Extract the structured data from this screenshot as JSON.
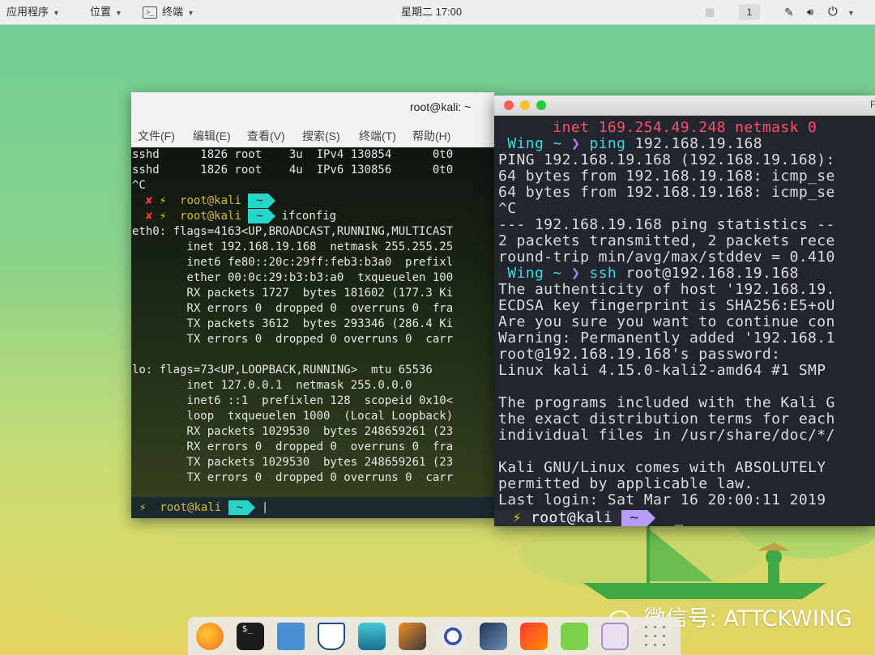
{
  "topbar": {
    "apps_menu": "应用程序",
    "places_menu": "位置",
    "terminal_menu": "终端",
    "clock": "星期二 17:00",
    "workspace": "1"
  },
  "term1": {
    "title": "root@kali: ~",
    "menu": [
      "文件(F)",
      "编辑(E)",
      "查看(V)",
      "搜索(S)",
      "终端(T)",
      "帮助(H)"
    ],
    "lines": [
      "sshd      1826 root    3u  IPv4 130854      0t0",
      "sshd      1826 root    4u  IPv6 130856      0t0",
      "^C",
      "",
      "",
      "eth0: flags=4163<UP,BROADCAST,RUNNING,MULTICAST",
      "        inet 192.168.19.168  netmask 255.255.25",
      "        inet6 fe80::20c:29ff:feb3:b3a0  prefixl",
      "        ether 00:0c:29:b3:b3:a0  txqueuelen 100",
      "        RX packets 1727  bytes 181602 (177.3 Ki",
      "        RX errors 0  dropped 0  overruns 0  fra",
      "        TX packets 3612  bytes 293346 (286.4 Ki",
      "        TX errors 0  dropped 0 overruns 0  carr",
      "",
      "lo: flags=73<UP,LOOPBACK,RUNNING>  mtu 65536",
      "        inet 127.0.0.1  netmask 255.0.0.0",
      "        inet6 ::1  prefixlen 128  scopeid 0x10<",
      "        loop  txqueuelen 1000  (Local Loopback)",
      "        RX packets 1029530  bytes 248659261 (23",
      "        RX errors 0  dropped 0  overruns 0  fra",
      "        TX packets 1029530  bytes 248659261 (23",
      "        TX errors 0  dropped 0 overruns 0  carr"
    ],
    "prompt_x": "✘",
    "prompt_bolt": "⚡",
    "prompt_user": "root@kali",
    "prompt_dir": "~",
    "command": "ifconfig",
    "cursor": "|"
  },
  "term2": {
    "title": "F",
    "lines": [
      "      inet 169.254.49.248 netmask 0",
      "",
      "PING 192.168.19.168 (192.168.19.168):",
      "64 bytes from 192.168.19.168: icmp_se",
      "64 bytes from 192.168.19.168: icmp_se",
      "^C",
      "--- 192.168.19.168 ping statistics --",
      "2 packets transmitted, 2 packets rece",
      "round-trip min/avg/max/stddev = 0.410",
      "",
      "The authenticity of host '192.168.19.",
      "ECDSA key fingerprint is SHA256:E5+oU",
      "Are you sure you want to continue con",
      "Warning: Permanently added '192.168.1",
      "root@192.168.19.168's password:",
      "Linux kali 4.15.0-kali2-amd64 #1 SMP ",
      "",
      "The programs included with the Kali G",
      "the exact distribution terms for each",
      "individual files in /usr/share/doc/*/",
      "",
      "Kali GNU/Linux comes with ABSOLUTELY ",
      "permitted by applicable law.",
      "Last login: Sat Mar 16 20:00:11 2019 "
    ],
    "prompt_host": "Wing",
    "prompt_dir": "~",
    "prompt_arrow": "❯",
    "cmd_ping": "ping",
    "cmd_ping_arg": "192.168.19.168",
    "cmd_ssh": "ssh",
    "cmd_ssh_arg": "root@192.168.19.168",
    "remote_bolt": "⚡",
    "remote_user": "root@kali",
    "remote_dir": "~",
    "cursor": "_"
  },
  "watermark": "微信号: ATTCKWING",
  "colors": {
    "term1_prompt_accent": "#28d3c8",
    "term2_prompt_accent": "#b79cff",
    "term2_cyan": "#3fd6e6"
  },
  "dock_icons": [
    "firefox-icon",
    "terminal-icon",
    "files-icon",
    "metasploit-icon",
    "armitage-icon",
    "burpsuite-icon",
    "maltego-icon",
    "beef-icon",
    "faraday-icon",
    "notes-icon",
    "settings-icon",
    "app-grid-icon"
  ]
}
